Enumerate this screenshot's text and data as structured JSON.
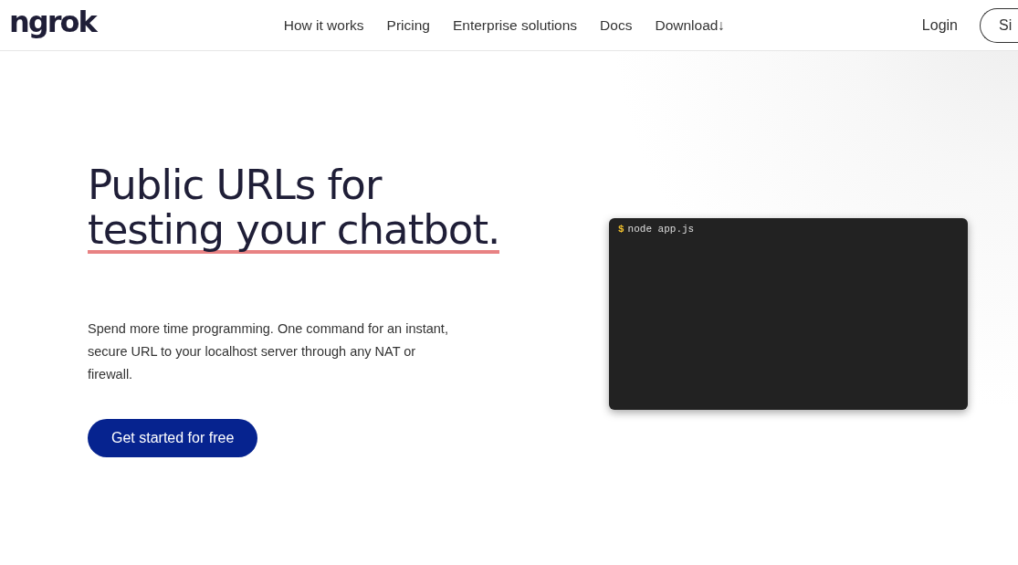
{
  "header": {
    "logo": "ngrok",
    "nav": [
      {
        "label": "How it works",
        "kind": "link"
      },
      {
        "label": "Pricing",
        "kind": "link"
      },
      {
        "label": "Enterprise solutions",
        "kind": "link"
      },
      {
        "label": "Docs",
        "kind": "link"
      },
      {
        "label": "Download",
        "kind": "dropdown",
        "icon": "↓"
      }
    ],
    "login": "Login",
    "signup": "Si"
  },
  "hero": {
    "title_lines": [
      {
        "text": "Public URLs for",
        "underlined": false
      },
      {
        "text": "testing your chatbot.",
        "underlined": true
      }
    ],
    "description": "Spend more time programming. One command for an instant, secure URL to your localhost server through any NAT or firewall.",
    "cta": "Get started for free"
  },
  "terminal": {
    "prompt": "$",
    "command": "node app.js"
  }
}
